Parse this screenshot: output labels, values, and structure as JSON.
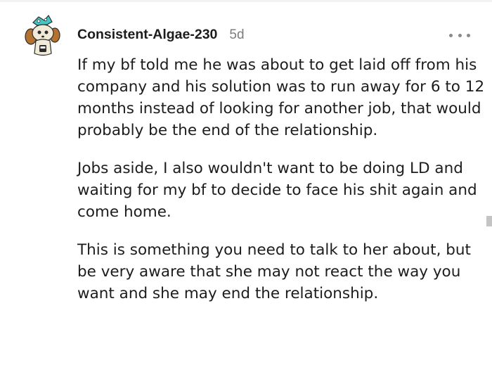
{
  "comment": {
    "author": "Consistent-Algae-230",
    "age": "5d",
    "more_label": "•••",
    "paragraphs": [
      "If my bf told me he was about to get laid off from his company and his solution was to run away for 6 to 12 months instead of looking for another job, that would probably be the end of the relationship.",
      "Jobs aside, I also wouldn't want to be doing LD and waiting for my bf to decide to face his shit again and come home.",
      "This is something you need to talk to her about, but be very aware that she may not react the way you want and she may end the relationship."
    ]
  },
  "avatar": {
    "icon": "snoo-avatar-icon",
    "colors": {
      "body": "#f2ead8",
      "ears": "#b5712f",
      "hat": "#43c7c5",
      "outline": "#2b2b2b"
    }
  }
}
